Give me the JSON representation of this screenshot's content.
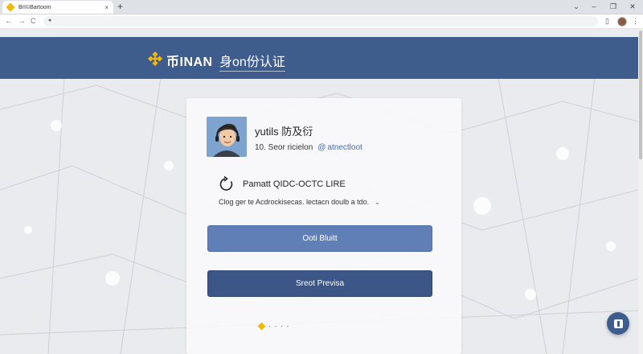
{
  "browser": {
    "tab_title": "BrI©Bartoom",
    "tab_close": "×",
    "new_tab": "+",
    "window_controls": {
      "minimize": "–",
      "maximize": "❐",
      "close": "✕",
      "dropdown": "⌄"
    },
    "nav": {
      "back": "←",
      "forward": "→",
      "reload": "C"
    },
    "lock_icon": "●",
    "menu_icon": "⋮",
    "extension_icon": "▯"
  },
  "header": {
    "brand": "币INAN",
    "title": "身on份认证",
    "brand_color": "#f0b90b",
    "bar_color": "#3e5d8d"
  },
  "profile": {
    "name": "yutils 防及衍",
    "id_prefix": "10. Seor ricielon",
    "at_icon": "@",
    "link": "atnectloot"
  },
  "qr": {
    "title": "Pamatt QIDC-OCTC LIRE",
    "description": "Clog ger te Acdrockisecas. lectacn doulb a tdo.",
    "chevron": "⌄"
  },
  "buttons": {
    "primary": "Ooti Bluitt",
    "secondary": "Sreot Previsa"
  },
  "footer": {
    "dots": "· · · ·"
  },
  "colors": {
    "primary_button": "#5f7fb6",
    "secondary_button": "#3c5687",
    "link": "#3e6cb6"
  }
}
